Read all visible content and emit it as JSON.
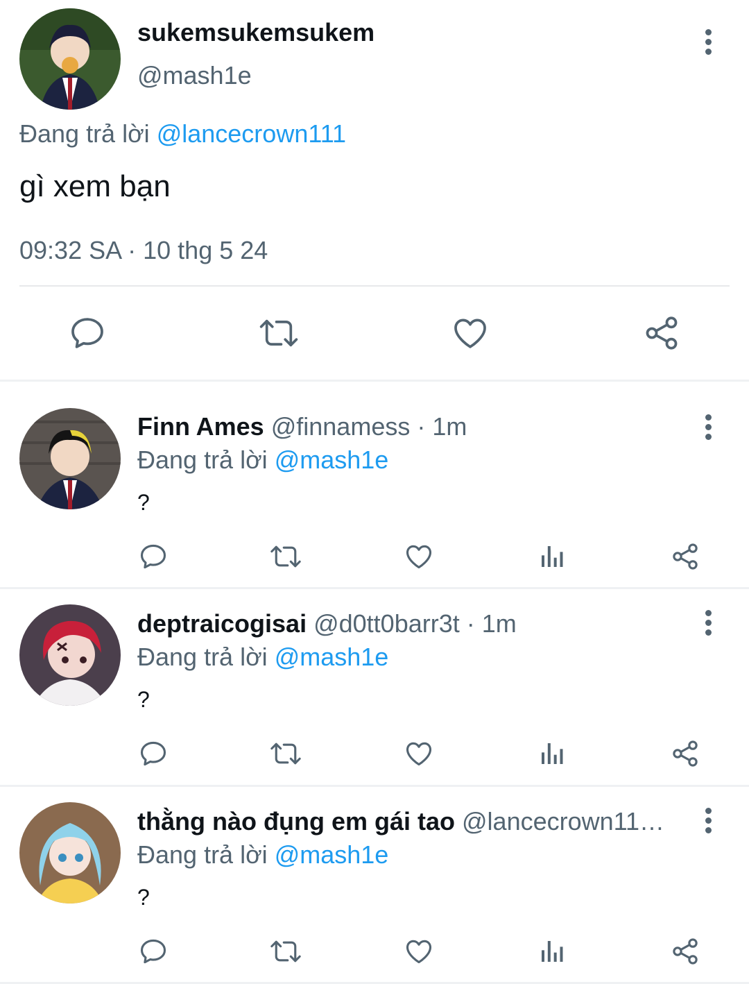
{
  "main_tweet": {
    "display_name": "sukemsukemsukem",
    "handle": "@mash1e",
    "reply_prefix": "Đang trả lời",
    "reply_mention": "@lancecrown111",
    "text": "gì xem bạn",
    "timestamp": "09:32 SA · 10 thg 5 24",
    "avatar_colors": [
      "#3b5a2e",
      "#1c2340"
    ]
  },
  "replies": [
    {
      "display_name": "Finn Ames",
      "handle": "@finnamess",
      "time": "· 1m",
      "reply_prefix": "Đang trả lời",
      "reply_mention": "@mash1e",
      "text": "?",
      "avatar_colors": [
        "#5a5450",
        "#1c2340"
      ]
    },
    {
      "display_name": "deptraicogisai",
      "handle": "@d0tt0barr3t",
      "time": "· 1m",
      "reply_prefix": "Đang trả lời",
      "reply_mention": "@mash1e",
      "text": "?",
      "avatar_colors": [
        "#c8203a",
        "#f2d7d0"
      ]
    },
    {
      "display_name": "thằng nào đụng em gái tao",
      "handle": "@lancecrown11…",
      "time": "",
      "reply_prefix": "Đang trả lời",
      "reply_mention": "@mash1e",
      "text": "?",
      "avatar_colors": [
        "#8fd2ea",
        "#f5cf52"
      ]
    }
  ],
  "icons": {
    "reply": "reply-icon",
    "retweet": "retweet-icon",
    "like": "heart-icon",
    "views": "views-icon",
    "share": "share-icon",
    "more": "more-vertical-icon"
  },
  "colors": {
    "accent": "#1d9bf0",
    "secondary_text": "#536471",
    "icon": "#536471"
  }
}
